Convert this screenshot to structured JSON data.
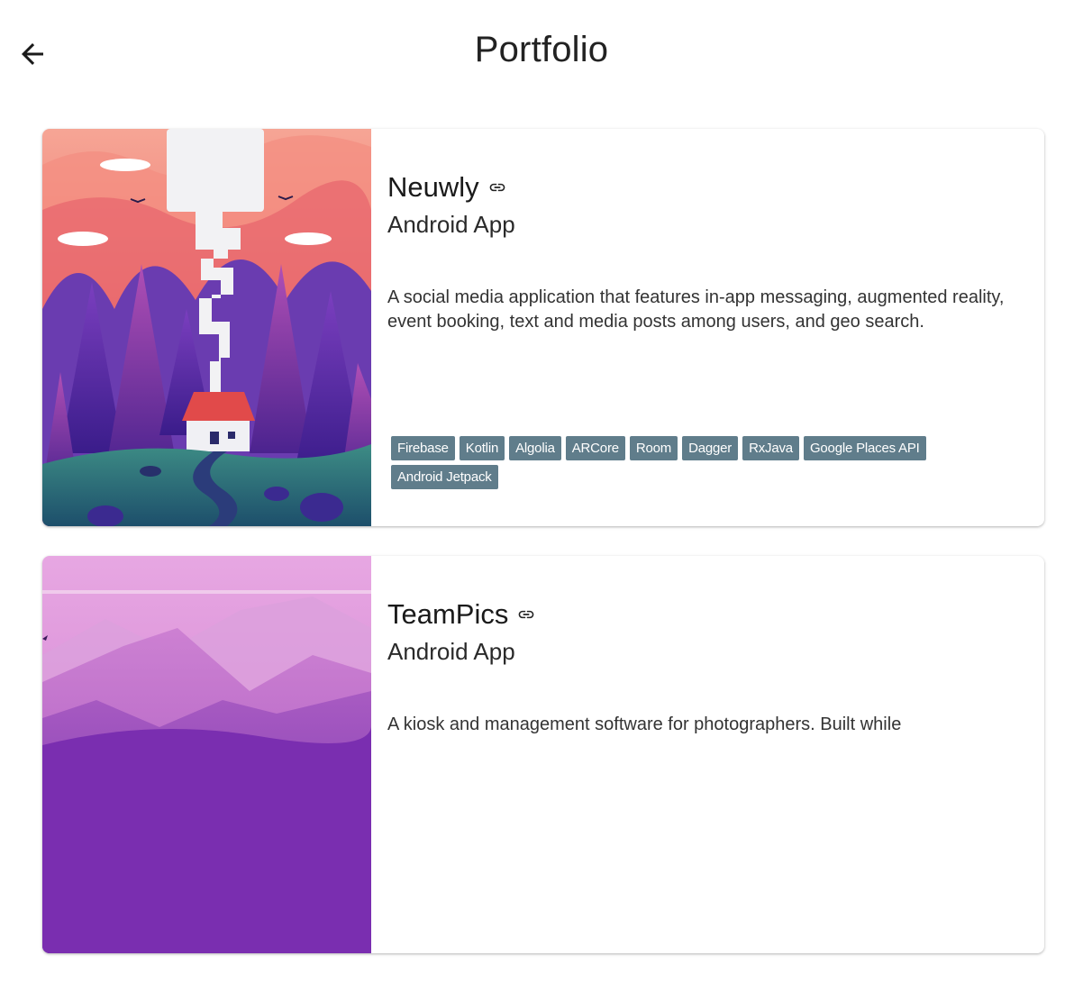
{
  "header": {
    "title": "Portfolio"
  },
  "projects": [
    {
      "title": "Neuwly",
      "subtitle": "Android App",
      "description": "A social media application that features in-app messaging, augmented reality, event booking, text and media posts among users, and geo search.",
      "tags": [
        "Firebase",
        "Kotlin",
        "Algolia",
        "ARCore",
        "Room",
        "Dagger",
        "RxJava",
        "Google Places API",
        "Android Jetpack"
      ]
    },
    {
      "title": "TeamPics",
      "subtitle": "Android App",
      "description": "A kiosk and management software for photographers. Built while"
    }
  ],
  "colors": {
    "tag_bg": "#607d8b",
    "tag_text": "#ffffff"
  }
}
